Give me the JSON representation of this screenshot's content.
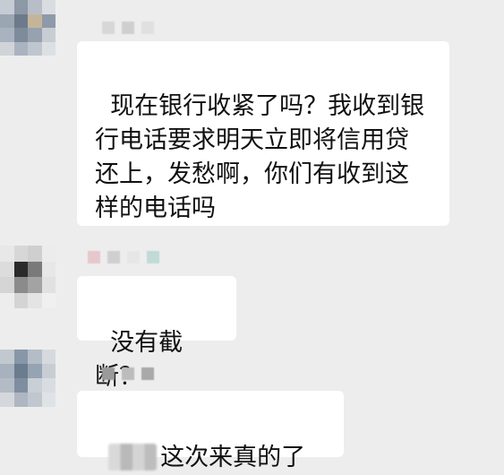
{
  "chat": {
    "messages": [
      {
        "sender": "contact-1",
        "text": "现在银行收紧了吗？我收到银行电话要求明天立即将信用贷还上，发愁啊，你们有收到这样的电话吗"
      },
      {
        "sender": "contact-2",
        "text": "没有截断？"
      },
      {
        "sender": "contact-3",
        "text": "这次来真的了"
      }
    ]
  }
}
